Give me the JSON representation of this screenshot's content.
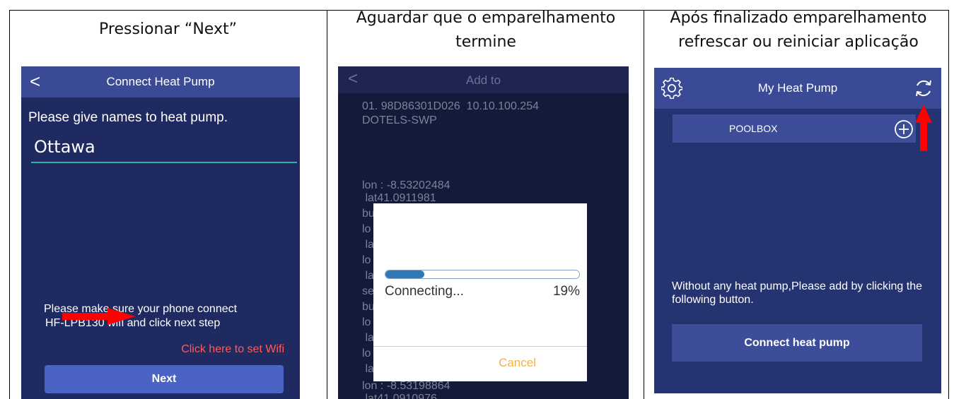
{
  "columns": [
    {
      "caption": "Pressionar “Next”"
    },
    {
      "caption": "Aguardar que o emparelhamento termine"
    },
    {
      "caption": "Após finalizado emparelhamento refrescar ou reiniciar aplicação"
    }
  ],
  "screen1": {
    "title": "Connect Heat Pump",
    "prompt": "Please give names to heat pump.",
    "name_value": "Ottawa",
    "hint_line1": "Please make sure your phone connect",
    "hint_line2": "HF-LPB130 wifi and click next step",
    "wifi_link": "Click here to set Wifi",
    "next_label": "Next"
  },
  "screen2": {
    "title": "Add to",
    "device_line1": "01. 98D86301D026  10.10.100.254",
    "device_line2": "DOTELS-SWP",
    "log_lon1": "lon : -8.53202484",
    "log_lat1": " lat41.0911981",
    "log_frag": [
      "bu",
      "lo",
      " la",
      "lo",
      " la",
      "se",
      "bu",
      "lo",
      " la",
      "lo",
      " la"
    ],
    "log_lon2": "lon : -8.53198864",
    "log_lat2": " lat41.0910976",
    "dialog": {
      "status": "Connecting...",
      "percent_text": "19%",
      "progress": 0.2,
      "cancel": "Cancel"
    }
  },
  "screen3": {
    "title": "My Heat Pump",
    "device_name": "POOLBOX",
    "message": "Without any heat pump,Please add by clicking the following button.",
    "connect_button": "Connect heat pump"
  },
  "colors": {
    "arrow": "#ff0000",
    "link": "#ff5a5a",
    "accent_button": "#4a63c4",
    "cancel": "#f0b24a"
  }
}
